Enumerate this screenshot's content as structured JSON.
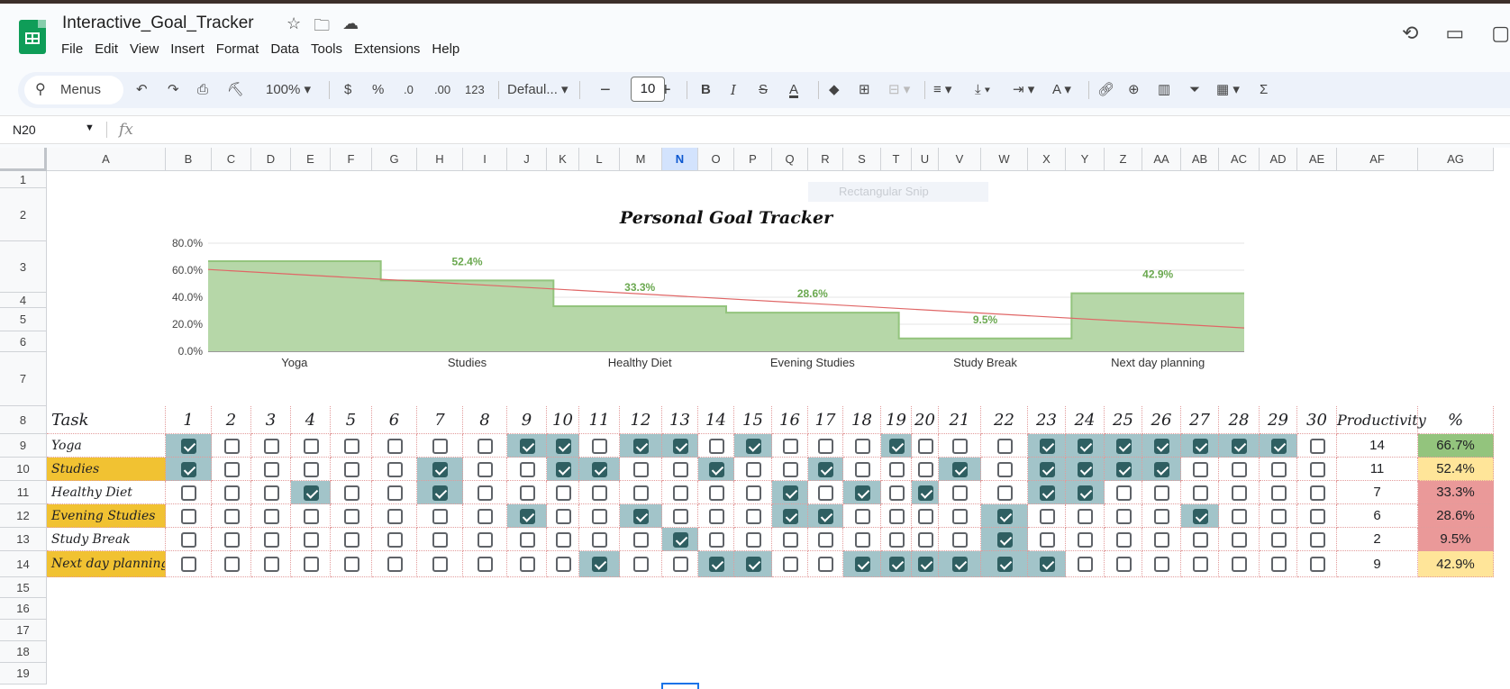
{
  "app": {
    "doc_title": "Interactive_Goal_Tracker",
    "menus": [
      "File",
      "Edit",
      "View",
      "Insert",
      "Format",
      "Data",
      "Tools",
      "Extensions",
      "Help"
    ]
  },
  "toolbar": {
    "search_label": "Menus",
    "zoom": "100%",
    "currency": "$",
    "percent": "%",
    "dec_decrease": ".0",
    "dec_increase": ".00",
    "number_format": "123",
    "font": "Defaul...",
    "font_size": "10"
  },
  "formula": {
    "cell_ref": "N20",
    "fx": "fx",
    "value": ""
  },
  "overlay": {
    "snip_label": "Rectangular Snip"
  },
  "columns": [
    "A",
    "B",
    "C",
    "D",
    "E",
    "F",
    "G",
    "H",
    "I",
    "J",
    "K",
    "L",
    "M",
    "N",
    "O",
    "P",
    "Q",
    "R",
    "S",
    "T",
    "U",
    "V",
    "W",
    "X",
    "Y",
    "Z",
    "AA",
    "AB",
    "AC",
    "AD",
    "AE",
    "AF",
    "AG"
  ],
  "selected_column": "N",
  "rows": [
    "1",
    "2",
    "3",
    "4",
    "5",
    "6",
    "7",
    "8",
    "9",
    "10",
    "11",
    "12",
    "13",
    "14",
    "15",
    "16",
    "17",
    "18",
    "19"
  ],
  "table": {
    "task_header": "Task",
    "productivity_header": "Productivity",
    "percent_header": "%",
    "days": [
      "1",
      "2",
      "3",
      "4",
      "5",
      "6",
      "7",
      "8",
      "9",
      "10",
      "11",
      "12",
      "13",
      "14",
      "15",
      "16",
      "17",
      "18",
      "19",
      "20",
      "21",
      "22",
      "23",
      "24",
      "25",
      "26",
      "27",
      "28",
      "29",
      "30"
    ],
    "tasks": [
      {
        "name": "Yoga",
        "highlight": false,
        "productivity": "14",
        "percent": "66.7%",
        "pct_color": "#93c47d",
        "checks": [
          1,
          0,
          0,
          0,
          0,
          0,
          0,
          0,
          1,
          1,
          0,
          1,
          1,
          0,
          1,
          0,
          0,
          0,
          1,
          0,
          0,
          0,
          1,
          1,
          1,
          1,
          1,
          1,
          1,
          0
        ]
      },
      {
        "name": "Studies",
        "highlight": true,
        "productivity": "11",
        "percent": "52.4%",
        "pct_color": "#ffe599",
        "checks": [
          1,
          0,
          0,
          0,
          0,
          0,
          1,
          0,
          0,
          1,
          1,
          0,
          0,
          1,
          0,
          0,
          1,
          0,
          0,
          0,
          1,
          0,
          1,
          1,
          1,
          1,
          0,
          0,
          0,
          0
        ]
      },
      {
        "name": "Healthy Diet",
        "highlight": false,
        "productivity": "7",
        "percent": "33.3%",
        "pct_color": "#ea9999",
        "checks": [
          0,
          0,
          0,
          1,
          0,
          0,
          1,
          0,
          0,
          0,
          0,
          0,
          0,
          0,
          0,
          1,
          0,
          1,
          0,
          1,
          0,
          0,
          1,
          1,
          0,
          0,
          0,
          0,
          0,
          0
        ]
      },
      {
        "name": "Evening Studies",
        "highlight": true,
        "productivity": "6",
        "percent": "28.6%",
        "pct_color": "#ea9999",
        "checks": [
          0,
          0,
          0,
          0,
          0,
          0,
          0,
          0,
          1,
          0,
          0,
          1,
          0,
          0,
          0,
          1,
          1,
          0,
          0,
          0,
          0,
          1,
          0,
          0,
          0,
          0,
          1,
          0,
          0,
          0
        ]
      },
      {
        "name": "Study Break",
        "highlight": false,
        "productivity": "2",
        "percent": "9.5%",
        "pct_color": "#ea9999",
        "checks": [
          0,
          0,
          0,
          0,
          0,
          0,
          0,
          0,
          0,
          0,
          0,
          0,
          1,
          0,
          0,
          0,
          0,
          0,
          0,
          0,
          0,
          1,
          0,
          0,
          0,
          0,
          0,
          0,
          0,
          0
        ]
      },
      {
        "name": "Next day planning",
        "highlight": true,
        "productivity": "9",
        "percent": "42.9%",
        "pct_color": "#ffe599",
        "checks": [
          0,
          0,
          0,
          0,
          0,
          0,
          0,
          0,
          0,
          0,
          1,
          0,
          0,
          1,
          1,
          0,
          0,
          1,
          1,
          1,
          1,
          1,
          1,
          0,
          0,
          0,
          0,
          0,
          0,
          0
        ]
      }
    ]
  },
  "chart_data": {
    "type": "area",
    "title": "Personal Goal Tracker",
    "categories": [
      "Yoga",
      "Studies",
      "Healthy Diet",
      "Evening Studies",
      "Study Break",
      "Next day planning"
    ],
    "values": [
      66.7,
      52.4,
      33.3,
      28.6,
      9.5,
      42.9
    ],
    "data_labels": [
      "",
      "52.4%",
      "33.3%",
      "28.6%",
      "9.5%",
      "42.9%"
    ],
    "yticks": [
      "80.0%",
      "60.0%",
      "40.0%",
      "20.0%",
      "0.0%"
    ],
    "ylim": [
      0,
      80
    ],
    "stepped": true,
    "trendline": true,
    "grid": true,
    "colors": {
      "fill": "#b6d7a8",
      "line": "#93c47d",
      "trend": "#e06666",
      "label": "#6aa84f"
    }
  }
}
